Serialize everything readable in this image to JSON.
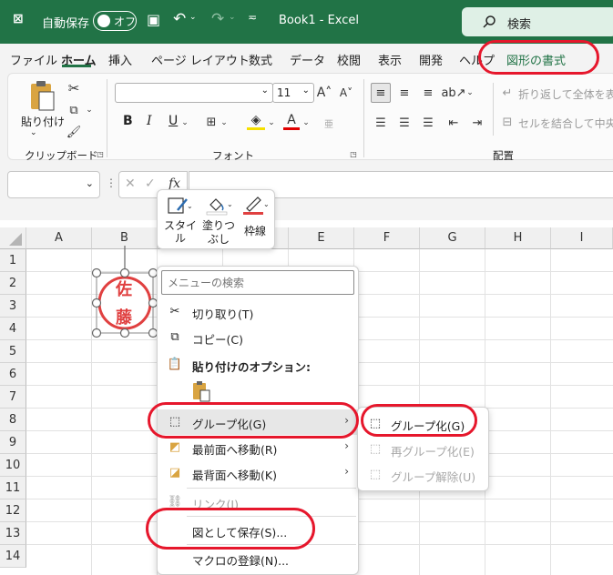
{
  "titlebar": {
    "autosave_label": "自動保存",
    "autosave_state": "オフ",
    "title": "Book1  -  Excel",
    "search_label": "検索"
  },
  "ribbon_tabs": [
    {
      "label": "ファイル"
    },
    {
      "label": "ホーム"
    },
    {
      "label": "挿入"
    },
    {
      "label": "ページ レイアウト"
    },
    {
      "label": "数式"
    },
    {
      "label": "データ"
    },
    {
      "label": "校閲"
    },
    {
      "label": "表示"
    },
    {
      "label": "開発"
    },
    {
      "label": "ヘルプ"
    },
    {
      "label": "図形の書式"
    }
  ],
  "ribbon": {
    "paste_label": "貼り付け",
    "clipboard_group": "クリップボード",
    "font_group": "フォント",
    "font_name": "",
    "font_size": "11",
    "alignment_group": "配置",
    "wrap_text": "折り返して全体を表示",
    "merge_center": "セルを結合して中央揃",
    "bold": "B",
    "italic": "I",
    "underline": "U"
  },
  "formula_bar": {
    "name_box": "",
    "fx": "fx",
    "formula": ""
  },
  "grid": {
    "columns": [
      "A",
      "B",
      "C",
      "D",
      "E",
      "F",
      "G",
      "H",
      "I"
    ],
    "rows": [
      "1",
      "2",
      "3",
      "4",
      "5",
      "6",
      "7",
      "8",
      "9",
      "10",
      "11",
      "12",
      "13",
      "14"
    ]
  },
  "seal": {
    "line1": "佐",
    "line2": "藤",
    "color": "#e04040"
  },
  "mini_toolbar": {
    "style": "スタイル",
    "fill_line1": "塗りつ",
    "fill_line2": "ぶし",
    "outline": "枠線"
  },
  "context_menu": {
    "search_placeholder": "メニューの検索",
    "items": [
      {
        "label": "切り取り(T)"
      },
      {
        "label": "コピー(C)"
      },
      {
        "label": "貼り付けのオプション:"
      },
      {
        "label": "グループ化(G)"
      },
      {
        "label": "最前面へ移動(R)"
      },
      {
        "label": "最背面へ移動(K)"
      },
      {
        "label": "リンク(I)"
      },
      {
        "label": "図として保存(S)..."
      },
      {
        "label": "マクロの登録(N)..."
      }
    ]
  },
  "submenu": {
    "items": [
      {
        "label": "グループ化(G)"
      },
      {
        "label": "再グループ化(E)"
      },
      {
        "label": "グループ解除(U)"
      }
    ]
  },
  "colors": {
    "excel_green": "#217346",
    "annotation_red": "#e6172c"
  }
}
